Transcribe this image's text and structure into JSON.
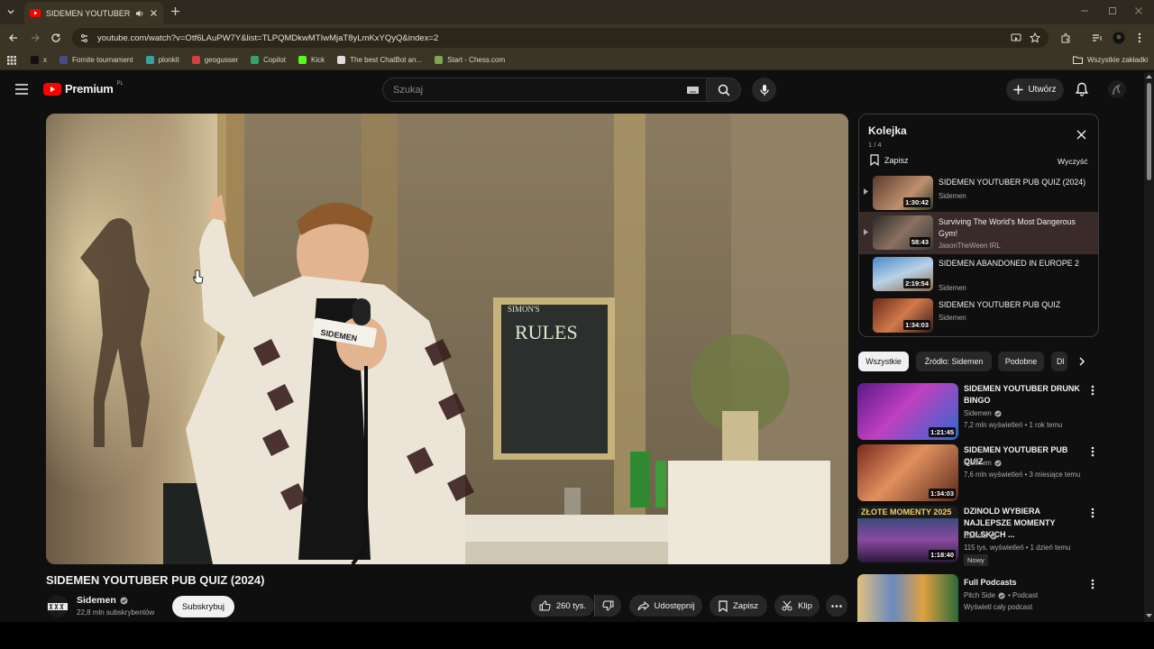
{
  "browser": {
    "tab_title": "SIDEMEN YOUTUBER PUB Q",
    "url": "youtube.com/watch?v=Otf6LAuPW7Y&list=TLPQMDkwMTIwMjaT8yLmKxYQyQ&index=2",
    "bookmarks": [
      {
        "label": "x",
        "color": "#111111"
      },
      {
        "label": "Fornite tournament",
        "color": "#4a4a8a"
      },
      {
        "label": "plonkit",
        "color": "#3aa0a0"
      },
      {
        "label": "geogusser",
        "color": "#d04040"
      },
      {
        "label": "Copilot",
        "color": "#3aa070"
      },
      {
        "label": "Kick",
        "color": "#53fc18"
      },
      {
        "label": "The best ChatBot an...",
        "color": "#dddddd"
      },
      {
        "label": "Start - Chess.com",
        "color": "#7fa650"
      }
    ],
    "all_bookmarks_label": "Wszystkie zakładki"
  },
  "header": {
    "logo_text": "Premium",
    "logo_region": "PL",
    "search_placeholder": "Szukaj",
    "create_label": "Utwórz"
  },
  "video": {
    "title": "SIDEMEN YOUTUBER PUB QUIZ (2024)",
    "channel": "Sidemen",
    "subscribers": "22,8 mln subskrybentów",
    "subscribe_label": "Subskrybuj",
    "likes": "260 tys.",
    "share_label": "Udostępnij",
    "save_label": "Zapisz",
    "clip_label": "Klip",
    "board_text": "RULES",
    "board_heading": "SIMON'S",
    "mic_text": "SIDEMEN"
  },
  "queue": {
    "title": "Kolejka",
    "position": "1 / 4",
    "save_label": "Zapisz",
    "clear_label": "Wyczyść",
    "items": [
      {
        "title": "SIDEMEN YOUTUBER PUB QUIZ (2024)",
        "channel": "Sidemen",
        "duration": "1:30:42"
      },
      {
        "title": "Surviving The World's Most Dangerous Gym!",
        "channel": "JasonTheWeen IRL",
        "duration": "58:43"
      },
      {
        "title": "SIDEMEN ABANDONED IN EUROPE 2",
        "channel": "Sidemen",
        "duration": "2:19:54"
      },
      {
        "title": "SIDEMEN YOUTUBER PUB QUIZ",
        "channel": "Sidemen",
        "duration": "1:34:03"
      }
    ]
  },
  "chips": [
    "Wszystkie",
    "Źródło: Sidemen",
    "Podobne",
    "Dl"
  ],
  "recommendations": [
    {
      "title": "SIDEMEN YOUTUBER DRUNK BINGO",
      "channel": "Sidemen",
      "meta": "7,2 mln wyświetleń • 1 rok temu",
      "duration": "1:21:45"
    },
    {
      "title": "SIDEMEN YOUTUBER PUB QUIZ",
      "channel": "Sidemen",
      "meta": "7,6 mln wyświetleń • 3 miesiące temu",
      "duration": "1:34:03"
    },
    {
      "title": "DZINOLD WYBIERA NAJLEPSZE MOMENTY POLSKICH ...",
      "channel": "Dzinold",
      "meta": "115 tys. wyświetleń • 1 dzień temu",
      "duration": "1:18:40",
      "badge": "Nowy",
      "thumb_text": "ZŁOTE MOMENTY 2025"
    },
    {
      "title": "Full Podcasts",
      "channel": "Pitch Side",
      "channel_suffix": "• Podcast",
      "meta": "Wyświetl cały podcast",
      "duration": ""
    }
  ]
}
